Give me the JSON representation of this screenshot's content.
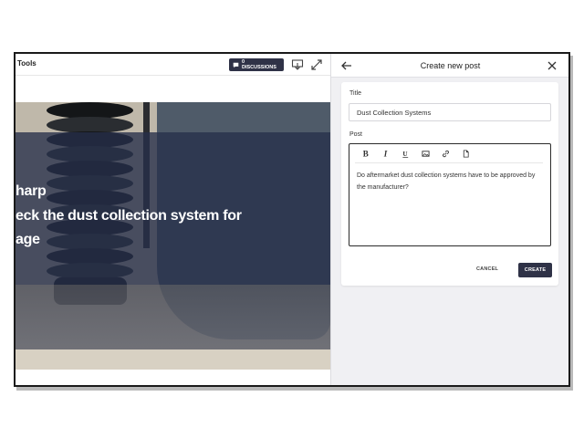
{
  "video_pane": {
    "title": "Tools",
    "discussions_label": "0 DISCUSSIONS",
    "captions": [
      "harp",
      "eck the dust collection system for",
      "age"
    ]
  },
  "panel": {
    "title": "Create new post",
    "title_label": "Title",
    "title_value": "Dust Collection Systems",
    "post_label": "Post",
    "post_body": "Do aftermarket dust collection systems have to be approved by the manufacturer?",
    "toolbar": [
      "bold-icon",
      "italic-icon",
      "underline-icon",
      "image-icon",
      "link-icon",
      "file-icon"
    ],
    "cancel_label": "CANCEL",
    "create_label": "CREATE"
  },
  "colors": {
    "accent_dark": "#2f3247",
    "panel_bg": "#f0f0f3"
  }
}
